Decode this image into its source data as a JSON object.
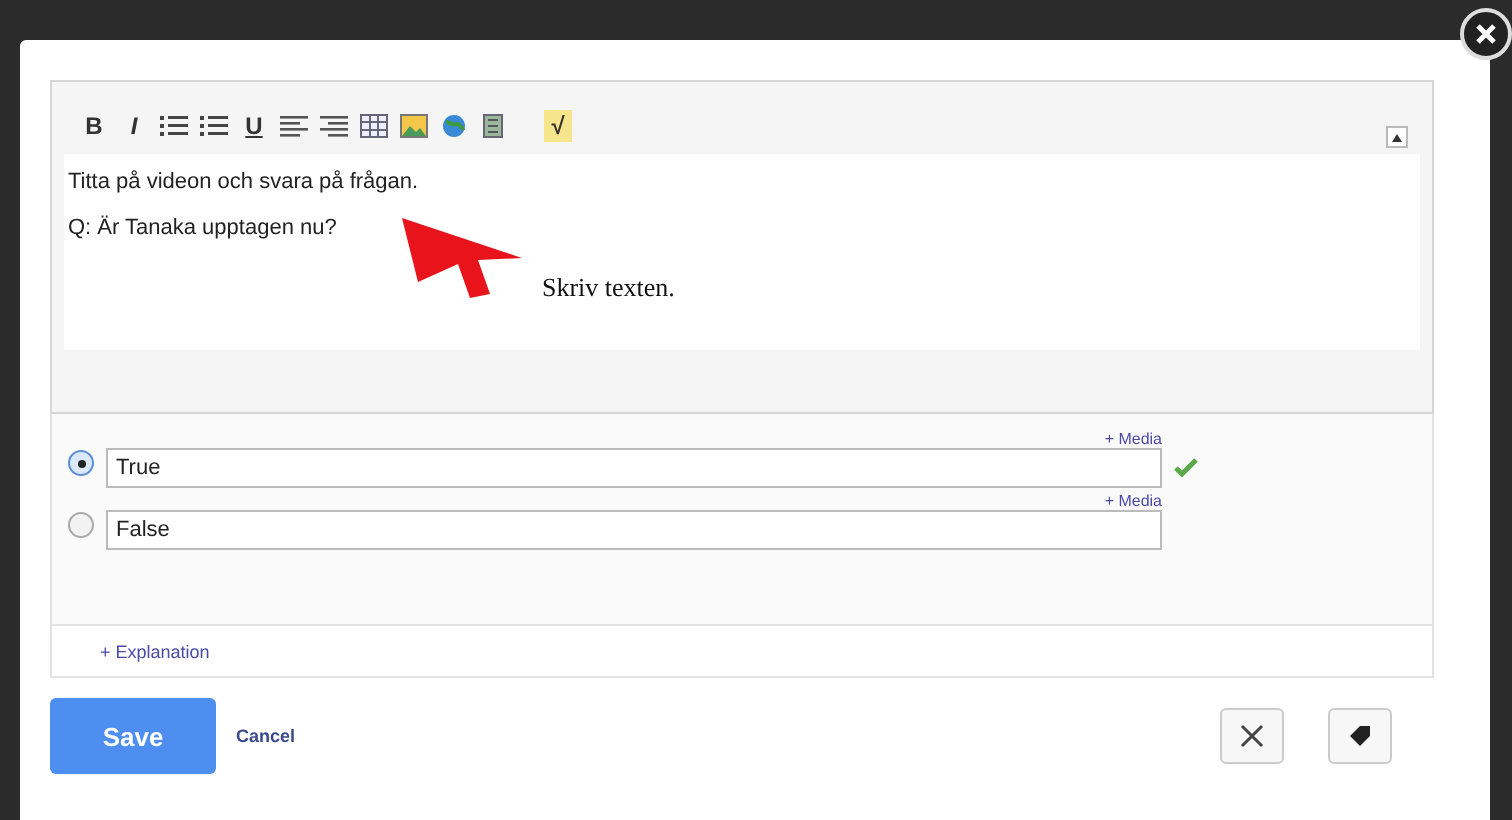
{
  "editor": {
    "toolbar": [
      {
        "kind": "bold",
        "label": "B"
      },
      {
        "kind": "italic",
        "label": "I"
      },
      {
        "kind": "ordered-list"
      },
      {
        "kind": "bullet-list"
      },
      {
        "kind": "underline",
        "label": "U"
      },
      {
        "kind": "align-left"
      },
      {
        "kind": "align-right"
      },
      {
        "kind": "table"
      },
      {
        "kind": "image"
      },
      {
        "kind": "globe"
      },
      {
        "kind": "document"
      },
      {
        "kind": "formula",
        "label": "√"
      }
    ],
    "lines": [
      "Titta på videon och svara på frågan.",
      "Q: Är Tanaka upptagen nu?"
    ],
    "annotation": "Skriv texten."
  },
  "answers": [
    {
      "text": "True",
      "selected": true,
      "correct": true,
      "media": "+ Media"
    },
    {
      "text": "False",
      "selected": false,
      "correct": false,
      "media": "+ Media"
    }
  ],
  "explanation": "+ Explanation",
  "buttons": {
    "save": "Save",
    "cancel": "Cancel"
  }
}
